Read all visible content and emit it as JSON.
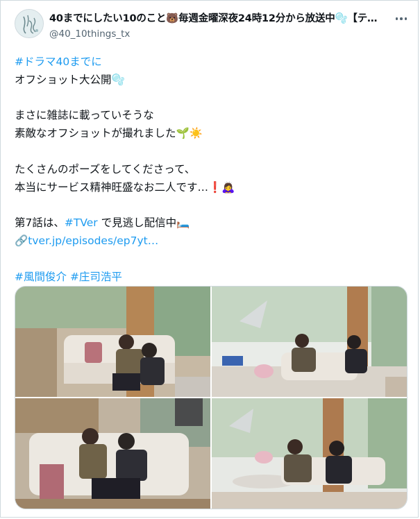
{
  "tweet": {
    "display_name": "40までにしたい10のこと🐻毎週金曜深夜24時12分から放送中🫧【テ…",
    "handle": "@40_10things_tx",
    "lines": [
      {
        "text": "#ドラマ40までに",
        "kind": "tag"
      },
      {
        "text": "オフショット大公開🫧",
        "kind": "text"
      },
      {
        "text": "",
        "kind": "gap"
      },
      {
        "text": "まさに雑誌に載っていそうな",
        "kind": "text"
      },
      {
        "text": "素敵なオフショットが撮れました🌱☀️",
        "kind": "text"
      },
      {
        "text": "",
        "kind": "gap"
      },
      {
        "text": "たくさんのポーズをしてくださって、",
        "kind": "text"
      },
      {
        "text": "本当にサービス精神旺盛なお二人です…❗️🙇‍♀️",
        "kind": "text"
      },
      {
        "text": "",
        "kind": "gap"
      }
    ],
    "episode_line": {
      "prefix": "第7話は、",
      "tag": "#TVer",
      "suffix": " で見逃し配信中🛏️"
    },
    "link": "🔗tver.jp/episodes/ep7yt…",
    "hashtags": [
      "#風間俊介",
      "#庄司浩平"
    ]
  },
  "icons": {
    "more": "more-options-icon",
    "avatar": "account-avatar"
  },
  "colors": {
    "link": "#1d9bf0",
    "secondary_text": "#536471",
    "border": "#cfd9de"
  }
}
